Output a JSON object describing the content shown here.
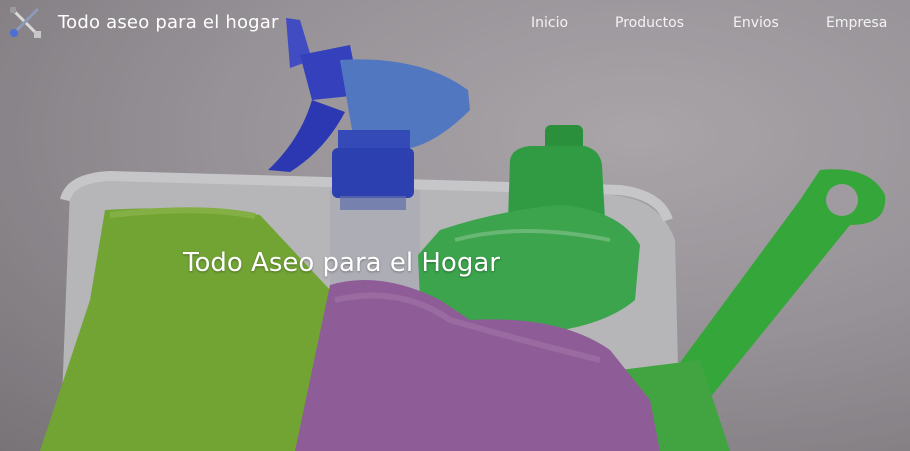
{
  "header": {
    "brand_name": "Todo aseo para el hogar",
    "logo_icon": "cleaning-tools-icon"
  },
  "nav": {
    "items": [
      {
        "label": "Inicio"
      },
      {
        "label": "Productos"
      },
      {
        "label": "Envios"
      },
      {
        "label": "Empresa"
      }
    ]
  },
  "hero": {
    "headline": "Todo Aseo para el Hogar",
    "image_subject": "cleaning-products-photo"
  },
  "colors": {
    "text": "#ffffff",
    "spray_bottle": "#3a49e0",
    "detergent_bottle": "#35c24f",
    "green_cloth": "#86c23a",
    "purple_cloth": "#a86bb3",
    "green_handle": "#37c83e"
  }
}
